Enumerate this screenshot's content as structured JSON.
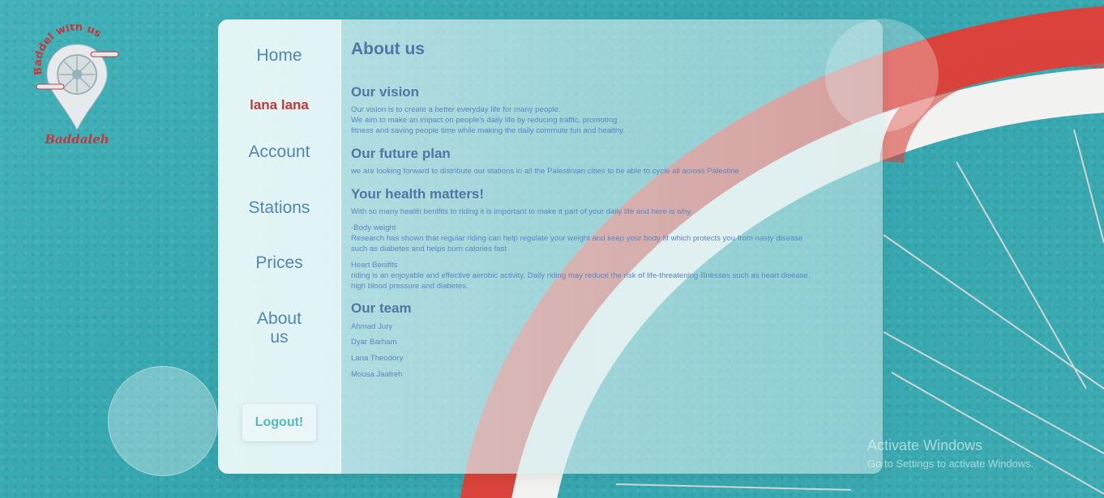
{
  "brand": {
    "arc_text": "Baddel with us",
    "name": "Baddaleh"
  },
  "nav": {
    "home": "Home",
    "user": "lana lana",
    "account": "Account",
    "stations": "Stations",
    "prices": "Prices",
    "about_line1": "About",
    "about_line2": "us"
  },
  "logout_label": "Logout!",
  "about": {
    "title": "About us",
    "vision_title": "Our vision",
    "vision_lines": [
      "Our vision is to create a better everyday life for many people.",
      "We aim to make an impact on people's daily life by reducing traffic, promoting",
      "fitness and saving people time while making the daily commute fun and healthy."
    ],
    "future_title": "Our future plan",
    "future_text": "we are looking forward to distribute our stations in all the Palestinian cities to be able to cycle all across Palestine",
    "health_title": "Your health matters!",
    "health_intro": "With so many health benifits to riding it is important to make it part of your daily life and here is why.",
    "body_weight_title": "-Body weight",
    "body_weight_lines": [
      "Research has shown that regular riding can help regulate your weight and keep your body fit which protects you from nasty disease",
      "such as diabetes and helps burn calories fast"
    ],
    "heart_title": "Heart Benifits",
    "heart_lines": [
      "riding is an enjoyable and effective aerobic activity. Daily riding may reduce the risk of life-threatening illnesses such as heart disease,",
      "high blood pressure and diabetes."
    ],
    "team_title": "Our team",
    "team": [
      "Ahmad Jury",
      "Dyar Barham",
      "Lana Theodory",
      "Mousa Jaafreh"
    ]
  },
  "watermark": {
    "line1": "Activate Windows",
    "line2": "Go to Settings to activate Windows."
  },
  "colors": {
    "background": "#3aa9b1",
    "accent": "#4f86b8",
    "user": "#c0393b",
    "logout": "#57b8c2",
    "tire": "#d9433b"
  },
  "icons": {
    "logo": "bike-wheel-map-pin-logo"
  }
}
